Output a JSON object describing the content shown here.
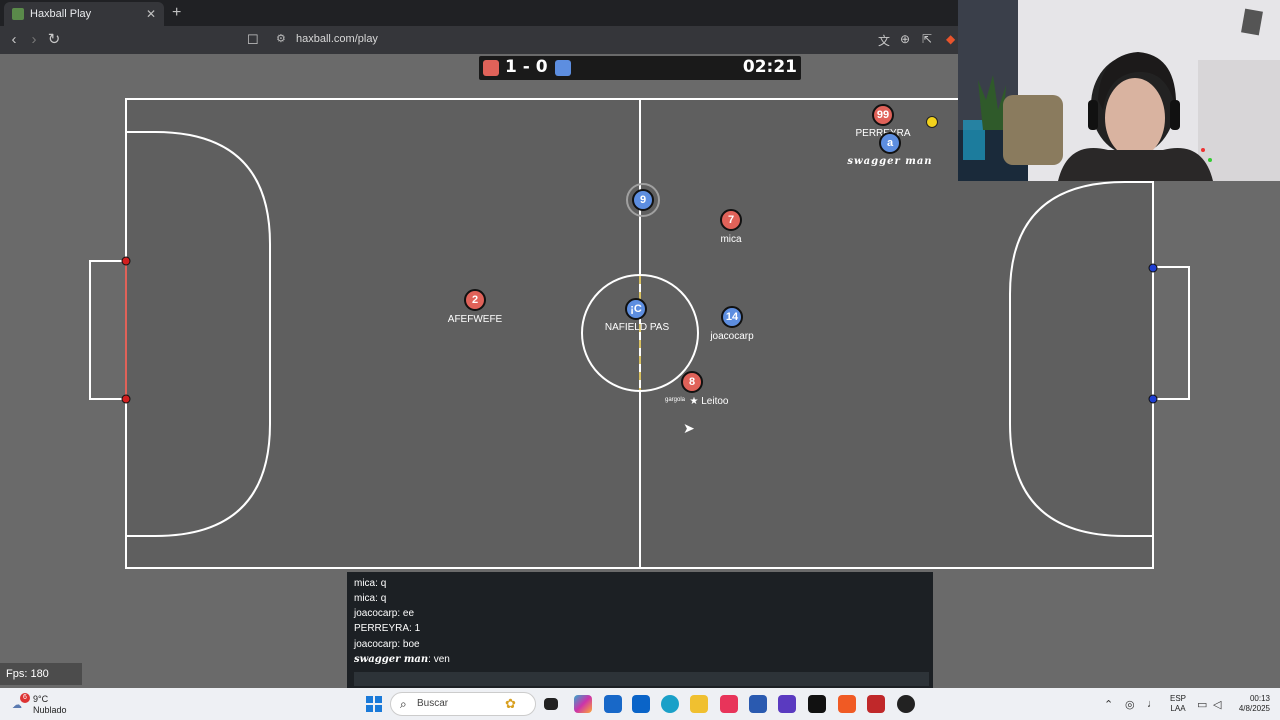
{
  "browser": {
    "tab_title": "Haxball Play",
    "tab_close": "✕",
    "new_tab": "+",
    "url": "haxball.com/play"
  },
  "game": {
    "score": "1 - 0",
    "timer": "02:21",
    "colors": {
      "red": "#e06259",
      "blue": "#5d8ee0",
      "ball": "#f2d21c",
      "field": "#6a6a6a",
      "lines": "#ffffff"
    },
    "players": [
      {
        "team": "red",
        "number": "99",
        "name": "PERREYRA"
      },
      {
        "team": "blue",
        "number": "a",
        "name": "swagger man"
      },
      {
        "team": "blue",
        "number": "9",
        "name": ""
      },
      {
        "team": "red",
        "number": "7",
        "name": "mica"
      },
      {
        "team": "red",
        "number": "2",
        "name": "AFEFWEFE"
      },
      {
        "team": "blue",
        "number": "¡C",
        "name": "NAFIELD PAS"
      },
      {
        "team": "blue",
        "number": "14",
        "name": "joacocarp"
      },
      {
        "team": "red",
        "number": "8",
        "name": "Leitoo"
      }
    ],
    "tag_gargola": "gargola"
  },
  "chat": {
    "messages": [
      {
        "user": "mica",
        "text": "q"
      },
      {
        "user": "mica",
        "text": "q"
      },
      {
        "user": "joacocarp",
        "text": "ee"
      },
      {
        "user": "PERREYRA",
        "text": "1"
      },
      {
        "user": "joacocarp",
        "text": "boe"
      },
      {
        "user": "swagger man",
        "text": "ven"
      }
    ]
  },
  "fps": "Fps: 180",
  "taskbar": {
    "weather_temp": "9°C",
    "weather_desc": "Nublado",
    "weather_badge": "6",
    "search_placeholder": "Buscar",
    "lang_top": "ESP",
    "lang_bottom": "LAA",
    "time": "00:13",
    "date": "4/8/2025"
  }
}
